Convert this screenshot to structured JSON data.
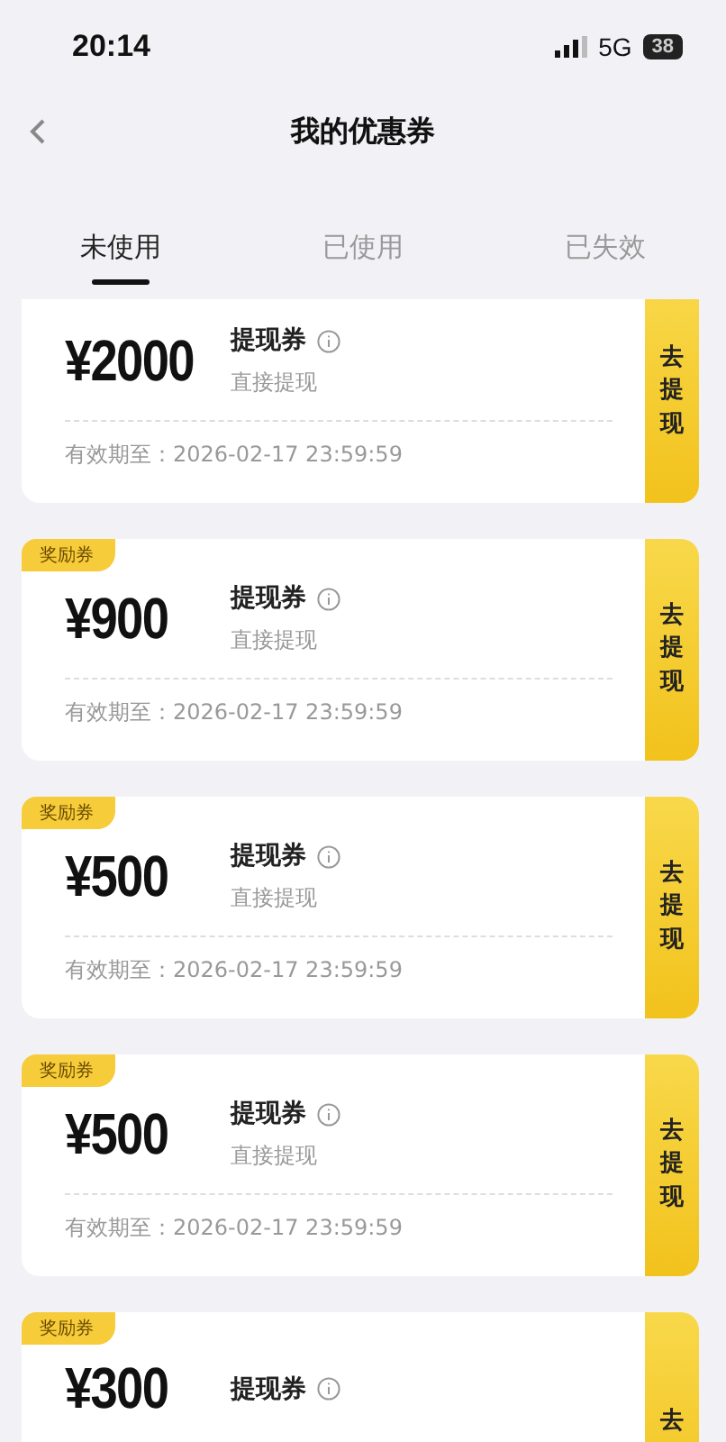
{
  "status_bar": {
    "time": "20:14",
    "network": "5G",
    "battery": "38"
  },
  "header": {
    "title": "我的优惠券"
  },
  "tabs": [
    {
      "label": "未使用",
      "selected": true
    },
    {
      "label": "已使用",
      "selected": false
    },
    {
      "label": "已失效",
      "selected": false
    }
  ],
  "coupons": [
    {
      "amount": "¥2000",
      "title": "提现券",
      "subtitle": "直接提现",
      "expiry": "有效期至：2026-02-17 23:59:59",
      "action": "去提现"
    },
    {
      "badge": "奖励券",
      "amount": "¥900",
      "title": "提现券",
      "subtitle": "直接提现",
      "expiry": "有效期至：2026-02-17 23:59:59",
      "action": "去提现"
    },
    {
      "badge": "奖励券",
      "amount": "¥500",
      "title": "提现券",
      "subtitle": "直接提现",
      "expiry": "有效期至：2026-02-17 23:59:59",
      "action": "去提现"
    },
    {
      "badge": "奖励券",
      "amount": "¥500",
      "title": "提现券",
      "subtitle": "直接提现",
      "expiry": "有效期至：2026-02-17 23:59:59",
      "action": "去提现"
    },
    {
      "badge": "奖励券",
      "amount": "¥300",
      "title": "提现券",
      "action": "去"
    }
  ]
}
